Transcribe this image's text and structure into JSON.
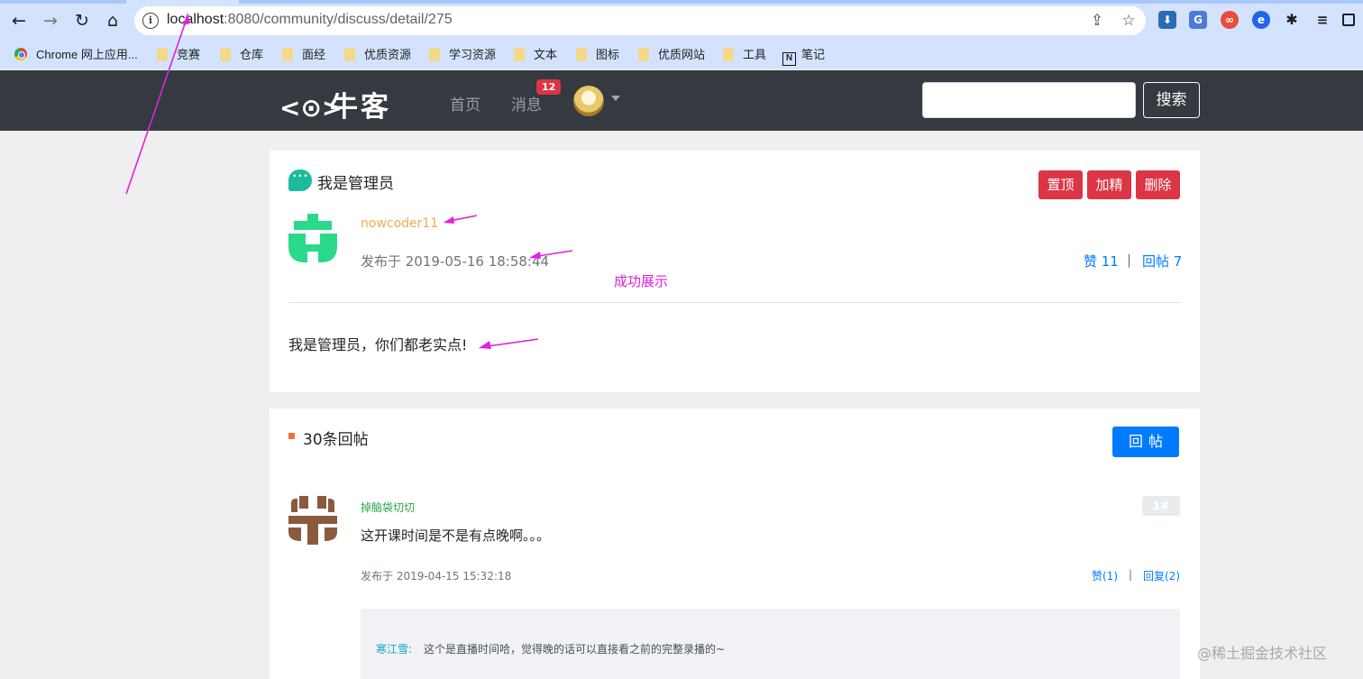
{
  "browser": {
    "url_host": "localhost",
    "url_rest": ":8080/community/discuss/detail/275",
    "bookmarks": [
      {
        "label": "Chrome 网上应用..."
      },
      {
        "label": "竞赛"
      },
      {
        "label": "仓库"
      },
      {
        "label": "面经"
      },
      {
        "label": "优质资源"
      },
      {
        "label": "学习资源"
      },
      {
        "label": "文本"
      },
      {
        "label": "图标"
      },
      {
        "label": "优质网站"
      },
      {
        "label": "工具"
      },
      {
        "label": "笔记"
      }
    ]
  },
  "header": {
    "logo_text": "牛客",
    "nav_home": "首页",
    "nav_messages": "消息",
    "message_count": "12",
    "search_button": "搜索"
  },
  "post": {
    "title": "我是管理员",
    "actions": {
      "top": "置顶",
      "highlight": "加精",
      "delete": "删除"
    },
    "author": "nowcoder11",
    "published": "发布于 2019-05-16 18:58:44",
    "likes": "赞 11",
    "separator": "|",
    "replies": "回帖 7",
    "body": "我是管理员，你们都老实点!"
  },
  "annotation": {
    "success_text": "成功展示"
  },
  "replies_section": {
    "count_label": "30条回帖",
    "reply_button": "回帖",
    "items": [
      {
        "user": "掉脑袋切切",
        "floor": "1#",
        "content": "这开课时间是不是有点晚啊。。。",
        "published": "发布于 2019-04-15 15:32:18",
        "likes": "赞(1)",
        "separator": "|",
        "reply": "回复(2)",
        "sub_reply": {
          "user": "寒江雪:",
          "content": "这个是直播时间哈，觉得晚的话可以直接看之前的完整录播的~"
        }
      }
    ]
  },
  "watermark": "@稀土掘金技术社区",
  "colors": {
    "header_bg": "#343a40",
    "danger": "#dc3545",
    "primary": "#007bff",
    "author_gold": "#f0ad4e",
    "reply_user_green": "#28a745",
    "annotation_magenta": "#e020e0"
  }
}
